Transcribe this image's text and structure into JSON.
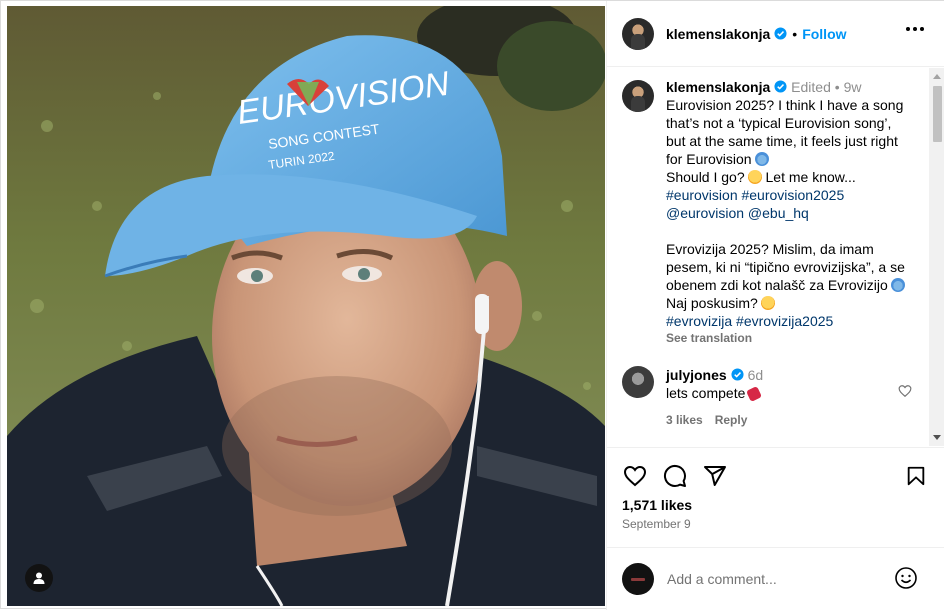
{
  "post": {
    "author": "klemenslakonja",
    "follow_label": "Follow",
    "dot": "•"
  },
  "caption": {
    "username": "klemenslakonja",
    "edited": "Edited",
    "dot": "•",
    "age": "9w",
    "lines": [
      "Eurovision 2025? I think I have a song",
      "that’s not a ‘typical Eurovision song’,",
      "but at the same time, it feels just right",
      "for Eurovision"
    ],
    "line_should": "Should I go?",
    "line_letme": " Let me know...",
    "hashtags_en": "#eurovision #eurovision2025",
    "mentions": "@eurovision @ebu_hq",
    "sl_lines": [
      "Evrovizija 2025? Mislim, da imam",
      "pesem, ki ni “tipično evrovizijska”, a se",
      "obenem zdi kot nalašč za Evrovizijo",
      "Naj poskusim?"
    ],
    "hashtags_sl": "#evrovizija #evrovizija2025",
    "see_translation": "See translation"
  },
  "reply": {
    "username": "julyjones",
    "age": "6d",
    "text": "lets compete",
    "likes": "3 likes",
    "reply_label": "Reply"
  },
  "stats": {
    "likes": "1,571 likes",
    "date": "September 9"
  },
  "comment_box": {
    "placeholder": "Add a comment..."
  },
  "icons": {
    "verified": "verified-badge-icon",
    "more": "more-options-icon",
    "like": "heart-icon",
    "comment": "comment-icon",
    "share": "share-icon",
    "save": "bookmark-icon",
    "emoji": "emoji-icon",
    "user_tag": "user-tag-icon"
  },
  "colors": {
    "accent": "#0095f6",
    "verified": "#0095f6",
    "link": "#00376b",
    "muted": "#737373"
  }
}
